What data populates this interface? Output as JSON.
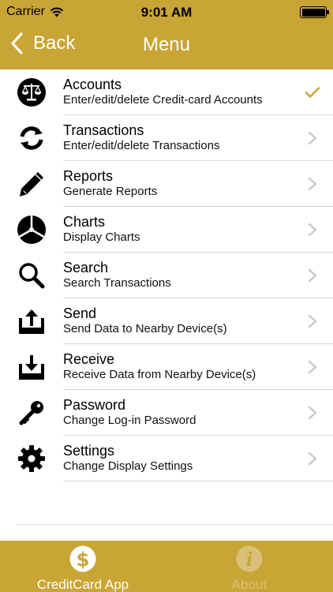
{
  "status_bar": {
    "carrier": "Carrier",
    "time": "9:01 AM"
  },
  "nav": {
    "back_label": "Back",
    "title": "Menu"
  },
  "menu": {
    "items": [
      {
        "title": "Accounts",
        "subtitle": "Enter/edit/delete Credit-card Accounts",
        "icon": "scales-icon",
        "accessory": "checkmark"
      },
      {
        "title": "Transactions",
        "subtitle": "Enter/edit/delete Transactions",
        "icon": "sync-arrows-icon",
        "accessory": "chevron"
      },
      {
        "title": "Reports",
        "subtitle": "Generate Reports",
        "icon": "pencil-icon",
        "accessory": "chevron"
      },
      {
        "title": "Charts",
        "subtitle": "Display Charts",
        "icon": "pie-chart-icon",
        "accessory": "chevron"
      },
      {
        "title": "Search",
        "subtitle": "Search Transactions",
        "icon": "magnifier-icon",
        "accessory": "chevron"
      },
      {
        "title": "Send",
        "subtitle": "Send Data to Nearby Device(s)",
        "icon": "upload-tray-icon",
        "accessory": "chevron"
      },
      {
        "title": "Receive",
        "subtitle": "Receive Data from Nearby Device(s)",
        "icon": "download-tray-icon",
        "accessory": "chevron"
      },
      {
        "title": "Password",
        "subtitle": "Change Log-in Password",
        "icon": "key-icon",
        "accessory": "chevron"
      },
      {
        "title": "Settings",
        "subtitle": "Change Display Settings",
        "icon": "gear-icon",
        "accessory": "chevron"
      }
    ]
  },
  "tabbar": {
    "tabs": [
      {
        "label": "CreditCard App",
        "icon": "dollar-icon",
        "active": true
      },
      {
        "label": "About",
        "icon": "info-icon",
        "active": false
      }
    ]
  },
  "colors": {
    "bar_gold": "#c9a535",
    "check_gold": "#c9a535",
    "chevron_gray": "#c7c7cc",
    "separator": "#d6d6d6"
  }
}
